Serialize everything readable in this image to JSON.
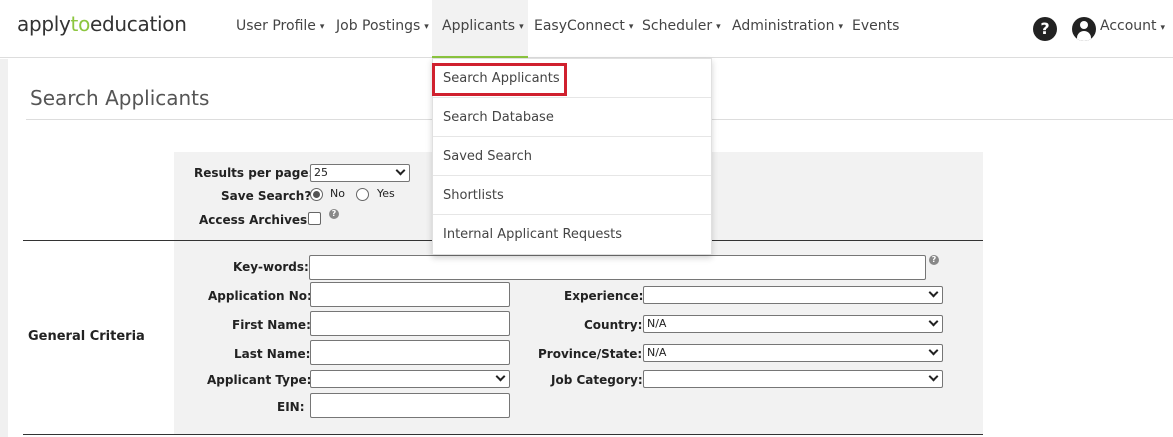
{
  "brand": {
    "logo_pre": "apply",
    "logo_accent": "to",
    "logo_post": "education",
    "accent_color": "#8cc63f"
  },
  "nav": {
    "items": [
      {
        "label": "User Profile",
        "has_caret": true
      },
      {
        "label": "Job Postings",
        "has_caret": true
      },
      {
        "label": "Applicants",
        "has_caret": true,
        "active": true
      },
      {
        "label": "EasyConnect",
        "has_caret": true
      },
      {
        "label": "Scheduler",
        "has_caret": true
      },
      {
        "label": "Administration",
        "has_caret": true
      },
      {
        "label": "Events",
        "has_caret": false
      }
    ],
    "help_icon": "help-circle-icon",
    "help_glyph": "?",
    "account_icon": "user-avatar-icon",
    "account_label": "Account",
    "caret": "▾"
  },
  "dropdown": {
    "items": [
      "Search Applicants",
      "Search Database",
      "Saved Search",
      "Shortlists",
      "Internal Applicant Requests"
    ],
    "highlight_color": "#d0202e"
  },
  "page": {
    "title": "Search Applicants"
  },
  "options": {
    "results_per_page_label": "Results per page:",
    "results_per_page_value": "25",
    "save_search_label": "Save Search?",
    "save_search_no": "No",
    "save_search_yes": "Yes",
    "access_archives_label": "Access Archives:",
    "help_glyph": "?"
  },
  "criteria": {
    "section_label": "General Criteria",
    "keywords_label": "Key-words:",
    "application_no_label": "Application No:",
    "first_name_label": "First Name:",
    "last_name_label": "Last Name:",
    "applicant_type_label": "Applicant Type:",
    "ein_label": "EIN:",
    "experience_label": "Experience:",
    "country_label": "Country:",
    "country_value": "N/A",
    "province_label": "Province/State:",
    "province_value": "N/A",
    "job_category_label": "Job Category:"
  }
}
